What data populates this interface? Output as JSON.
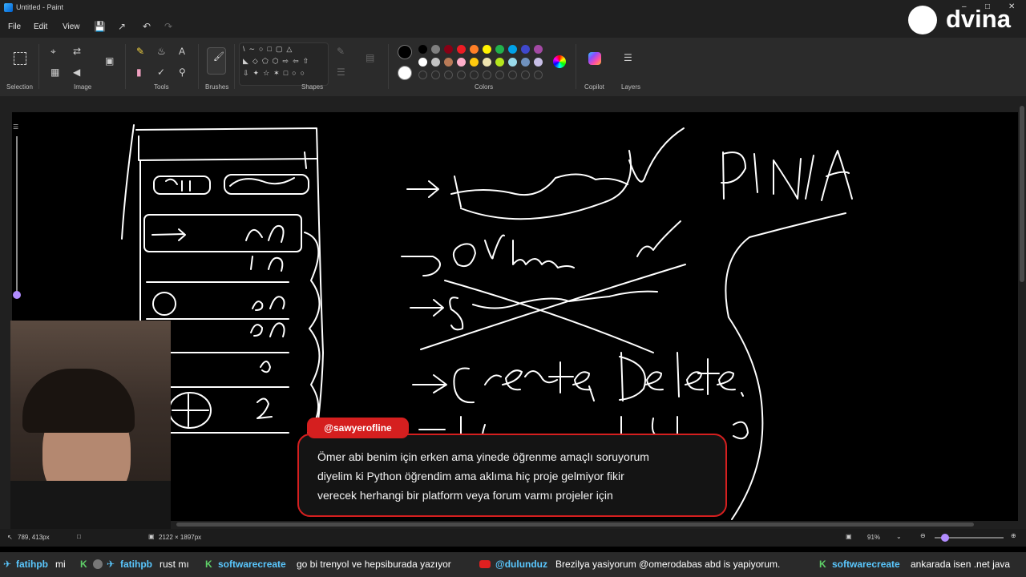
{
  "window": {
    "title": "Untitled - Paint"
  },
  "menu": {
    "file": "File",
    "edit": "Edit",
    "view": "View"
  },
  "ribbon": {
    "groups": {
      "selection": "Selection",
      "image": "Image",
      "tools": "Tools",
      "brushes": "Brushes",
      "shapes": "Shapes",
      "colors": "Colors",
      "copilot": "Copilot",
      "layers": "Layers"
    },
    "color_row1": [
      "#000000",
      "#7f7f7f",
      "#880015",
      "#ed1c24",
      "#ff7f27",
      "#fff200",
      "#22b14c",
      "#00a2e8",
      "#3f48cc",
      "#a349a4"
    ],
    "color_row2": [
      "#ffffff",
      "#c3c3c3",
      "#b97a57",
      "#ffaec9",
      "#ffc90e",
      "#efe4b0",
      "#b5e61d",
      "#99d9ea",
      "#7092be",
      "#c8bfe7"
    ],
    "primary_color": "#000000",
    "secondary_color": "#ffffff"
  },
  "status": {
    "cursor": "789, 413px",
    "canvas_size": "2122 × 1897px",
    "zoom": "91%"
  },
  "overlay": {
    "logo": "dvina",
    "chat_user": "@sawyerofline",
    "chat_lines": [
      "Ömer abi benim için erken ama yinede öğrenme amaçlı soruyorum",
      "diyelim ki Python öğrendim ama aklıma hiç proje gelmiyor fikir",
      "verecek herhangi bir platform veya forum varmı projeler için"
    ]
  },
  "ticker": [
    {
      "user": "fatihpb",
      "text": "mi"
    },
    {
      "user": "fatihpb",
      "text": "rust mı"
    },
    {
      "user": "softwarecreate",
      "text": "go bi trenyol ve hepsiburada yazıyor"
    },
    {
      "user": "@dulunduz",
      "text": "Brezilya yasiyorum @omerodabas abd is yapiyorum."
    },
    {
      "user": "softwarecreate",
      "text": "ankarada isen .net java"
    }
  ],
  "accent_colors": {
    "chat_red": "#d51f1f",
    "ticker_user": "#5ac8ff",
    "kick_green": "#53fc18"
  }
}
